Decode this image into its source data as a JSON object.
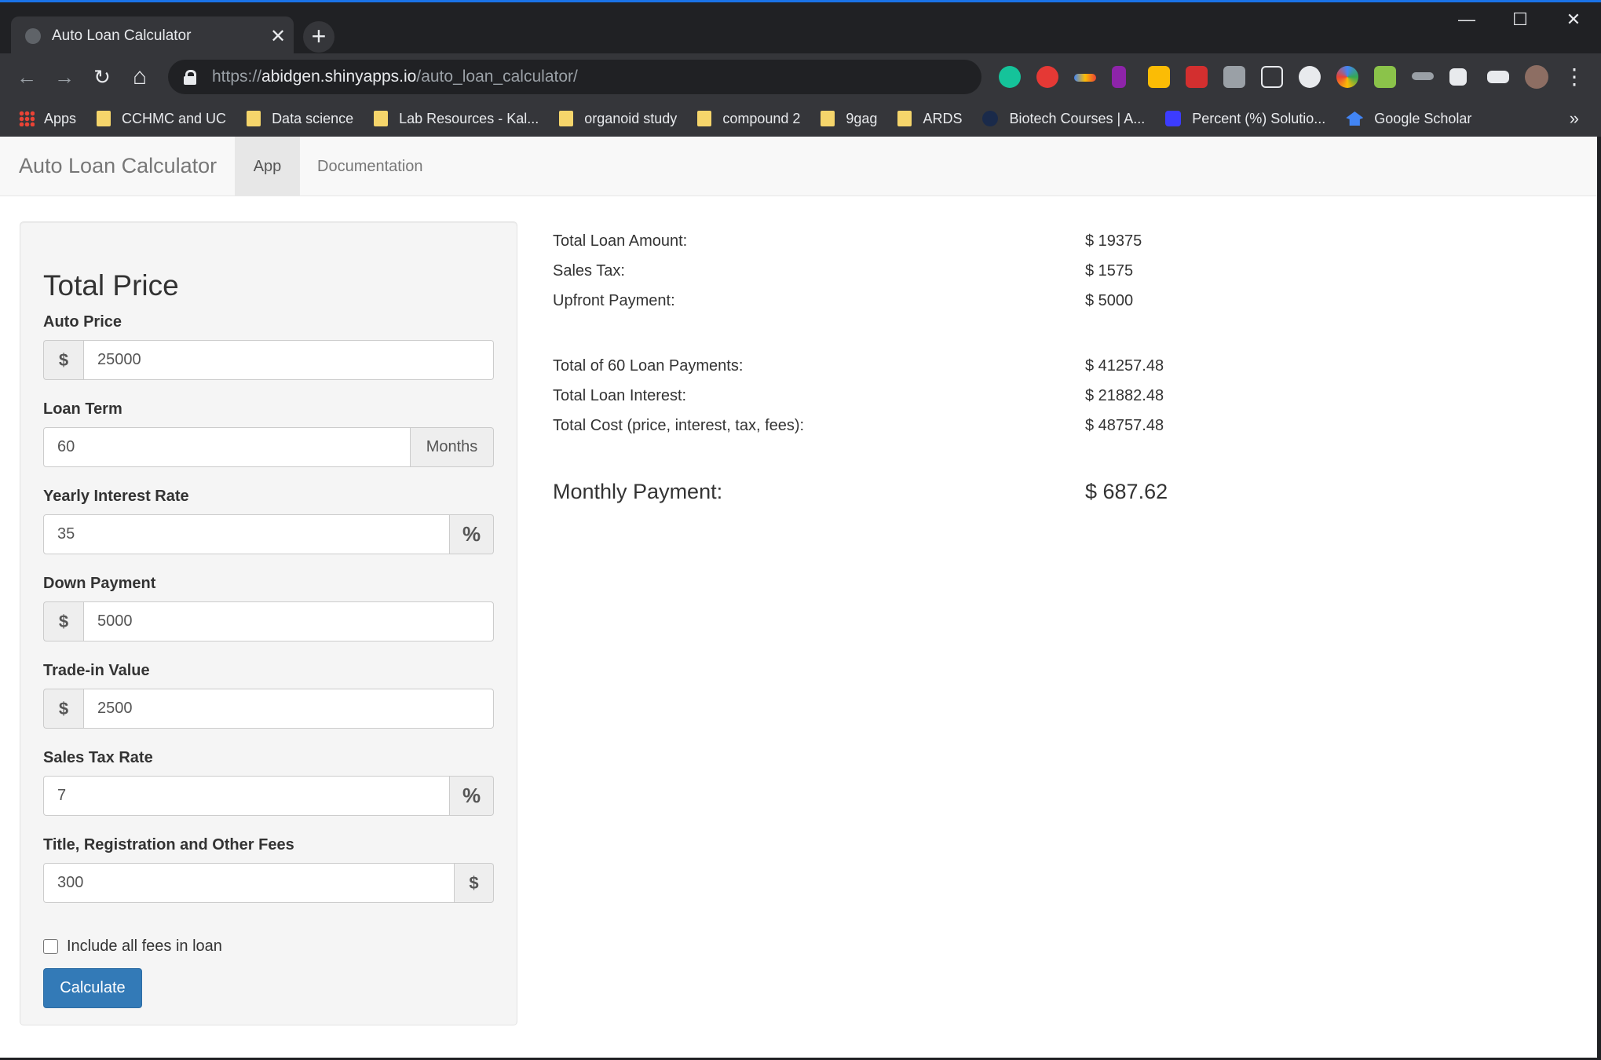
{
  "browser": {
    "tab_title": "Auto Loan Calculator",
    "tab_close": "✕",
    "new_tab": "+",
    "window_controls": {
      "minimize": "—",
      "maximize": "☐",
      "close": "✕"
    },
    "nav": {
      "back": "←",
      "forward": "→",
      "reload": "↻",
      "home": "⌂"
    },
    "url_scheme": "https://",
    "url_host": "abidgen.shinyapps.io",
    "url_path": "/auto_loan_calculator/",
    "menu": "⋮",
    "extension_icons": [
      "grammarly-icon",
      "adblock-icon",
      "rainbow-icon",
      "r-icon",
      "rotate-icon",
      "mendeley-icon",
      "r-box-icon",
      "p-box-icon",
      "circle-icon",
      "colorful-icon",
      "badge-icon",
      "w-icon",
      "puzzle-icon",
      "playlist-icon",
      "profile-avatar"
    ]
  },
  "bookmarks": {
    "items": [
      {
        "label": "Apps",
        "icon": "apps-grid-icon"
      },
      {
        "label": "CCHMC and UC",
        "icon": "folder-icon"
      },
      {
        "label": "Data science",
        "icon": "folder-icon"
      },
      {
        "label": "Lab Resources - Kal...",
        "icon": "folder-icon"
      },
      {
        "label": "organoid study",
        "icon": "folder-icon"
      },
      {
        "label": "compound 2",
        "icon": "folder-icon"
      },
      {
        "label": "9gag",
        "icon": "folder-icon"
      },
      {
        "label": "ARDS",
        "icon": "folder-icon"
      },
      {
        "label": "Biotech Courses | A...",
        "icon": "globe-icon"
      },
      {
        "label": "Percent (%) Solutio...",
        "icon": "puzzle-icon"
      },
      {
        "label": "Google Scholar",
        "icon": "scholar-icon"
      }
    ],
    "more": "»"
  },
  "navbar": {
    "brand": "Auto Loan Calculator",
    "tabs": [
      {
        "label": "App"
      },
      {
        "label": "Documentation"
      }
    ]
  },
  "form": {
    "heading": "Total Price",
    "auto_price": {
      "label": "Auto Price",
      "prefix": "$",
      "value": "25000"
    },
    "loan_term": {
      "label": "Loan Term",
      "value": "60",
      "suffix": "Months"
    },
    "interest_rate": {
      "label": "Yearly Interest Rate",
      "value": "35",
      "suffix": "%"
    },
    "down_payment": {
      "label": "Down Payment",
      "prefix": "$",
      "value": "5000"
    },
    "trade_in": {
      "label": "Trade-in Value",
      "prefix": "$",
      "value": "2500"
    },
    "sales_tax": {
      "label": "Sales Tax Rate",
      "value": "7",
      "suffix": "%"
    },
    "fees": {
      "label": "Title, Registration and Other Fees",
      "value": "300",
      "suffix": "$"
    },
    "include_fees_label": "Include all fees in loan",
    "include_fees_checked": false,
    "calculate_label": "Calculate",
    "button_color": "#337ab7"
  },
  "results": {
    "total_loan_amount": {
      "label": "Total Loan Amount:",
      "value": "$ 19375"
    },
    "sales_tax": {
      "label": "Sales Tax:",
      "value": "$ 1575"
    },
    "upfront_payment": {
      "label": "Upfront Payment:",
      "value": "$ 5000"
    },
    "total_payments": {
      "label": "Total of 60 Loan Payments:",
      "value": "$ 41257.48"
    },
    "total_interest": {
      "label": "Total Loan Interest:",
      "value": "$ 21882.48"
    },
    "total_cost": {
      "label": "Total Cost (price, interest, tax, fees):",
      "value": "$ 48757.48"
    },
    "monthly_payment": {
      "label": "Monthly Payment:",
      "value": "$ 687.62"
    }
  }
}
